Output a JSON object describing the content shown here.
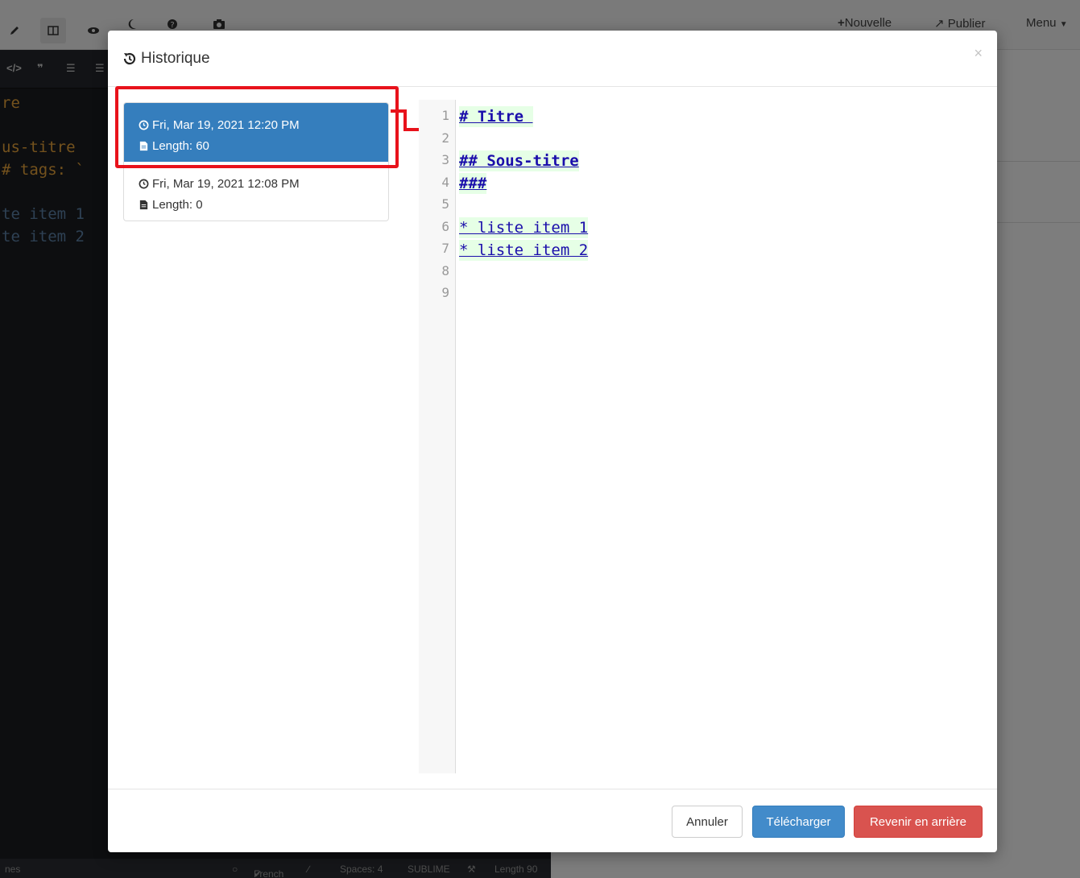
{
  "app": {
    "nav": {
      "new_label": "Nouvelle",
      "publish_label": "Publier",
      "menu_label": "Menu"
    },
    "editor": {
      "lines": [
        {
          "text": "re",
          "color": "orange"
        },
        {
          "text": "us-titre",
          "color": "orange"
        },
        {
          "text": "# tags: `",
          "color": "orange"
        },
        {
          "text": "te item 1",
          "color": "blue"
        },
        {
          "text": "te item 2",
          "color": "blue"
        }
      ]
    },
    "statusbar": {
      "left": "nes",
      "spellcheck": "French",
      "spaces": "Spaces: 4",
      "keymap": "SUBLIME",
      "length": "Length 90"
    }
  },
  "modal": {
    "title": "Historique",
    "close_label": "×",
    "history": [
      {
        "date": "Fri, Mar 19, 2021 12:20 PM",
        "length": "Length: 60",
        "selected": true
      },
      {
        "date": "Fri, Mar 19, 2021 12:08 PM",
        "length": "Length: 0",
        "selected": false
      }
    ],
    "viewer": {
      "line_numbers": [
        "1",
        "2",
        "3",
        "4",
        "5",
        "6",
        "7",
        "8",
        "9"
      ],
      "lines": [
        {
          "line": 1,
          "text": "# Titre "
        },
        {
          "line": 3,
          "text": "## Sous-titre"
        },
        {
          "line": 4,
          "text": "###"
        },
        {
          "line": 6,
          "text": "* liste item 1"
        },
        {
          "line": 7,
          "text": "* liste item 2"
        }
      ]
    },
    "buttons": {
      "cancel": "Annuler",
      "download": "Télécharger",
      "revert": "Revenir en arrière"
    }
  },
  "colors": {
    "selected_item": "#357ebd",
    "highlight": "#e8121b",
    "added_line_bg": "#e6ffe6",
    "danger": "#d9534f",
    "primary": "#428bca"
  }
}
